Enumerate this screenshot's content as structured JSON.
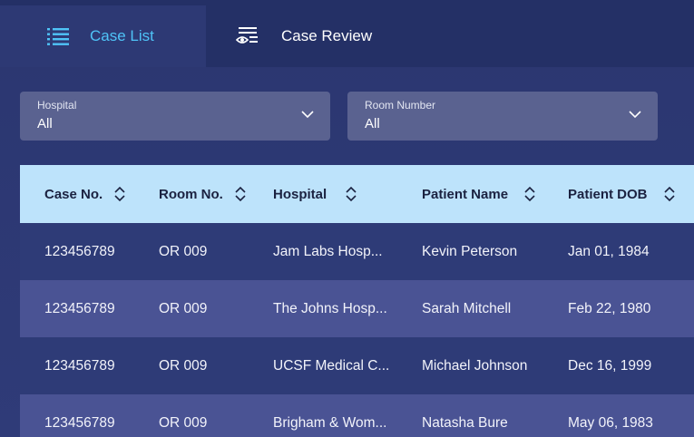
{
  "tabs": [
    {
      "label": "Case List",
      "icon": "list-icon",
      "active": true
    },
    {
      "label": "Case Review",
      "icon": "eye-list-icon",
      "active": false
    }
  ],
  "filters": {
    "hospital": {
      "label": "Hospital",
      "value": "All"
    },
    "room": {
      "label": "Room Number",
      "value": "All"
    }
  },
  "table": {
    "columns": [
      "Case No.",
      "Room No.",
      "Hospital",
      "Patient Name",
      "Patient DOB"
    ],
    "rows": [
      [
        "123456789",
        "OR 009",
        "Jam Labs Hosp...",
        "Kevin Peterson",
        "Jan 01, 1984"
      ],
      [
        "123456789",
        "OR 009",
        "The Johns Hosp...",
        "Sarah Mitchell",
        "Feb 22, 1980"
      ],
      [
        "123456789",
        "OR 009",
        "UCSF Medical C...",
        "Michael Johnson",
        "Dec 16, 1999"
      ],
      [
        "123456789",
        "OR 009",
        "Brigham & Wom...",
        "Natasha Bure",
        "May 06, 1983"
      ]
    ]
  },
  "colors": {
    "accent": "#4fc3f7",
    "header_bg": "#bde3fb",
    "row_dark": "#2e3b77",
    "row_light": "#4a5394"
  }
}
